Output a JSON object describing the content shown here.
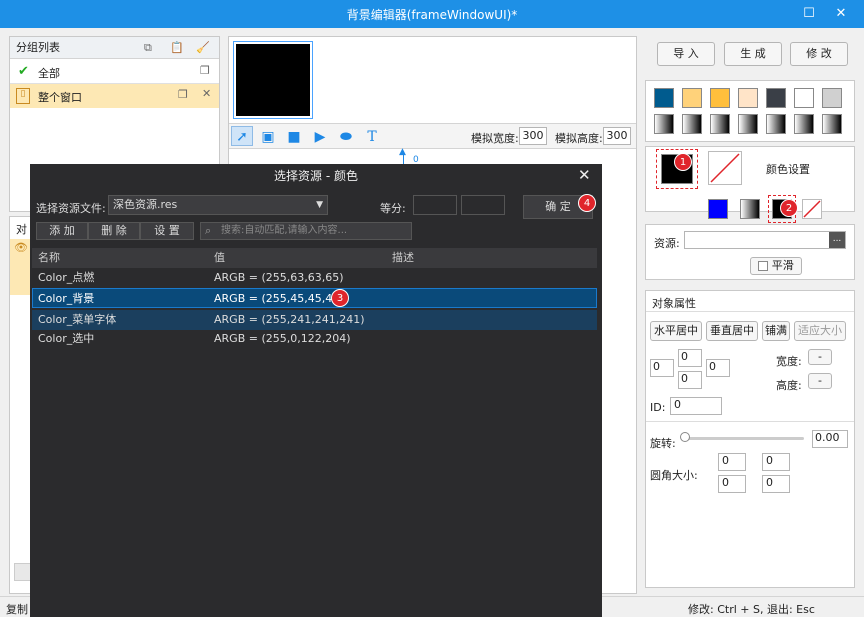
{
  "window": {
    "title": "背景编辑器(frameWindowUI)*",
    "maximize_icon": "maximize-icon",
    "close_icon": "close-icon"
  },
  "group_list": {
    "title": "分组列表",
    "items": [
      {
        "label": "全部",
        "icon": "check-icon"
      },
      {
        "label": "整个窗口",
        "icon": "window-icon"
      }
    ]
  },
  "object_panel": {
    "title_partial": "对"
  },
  "canvas": {
    "sim_width_label": "模拟宽度:",
    "sim_width": "300",
    "sim_height_label": "模拟高度:",
    "sim_height": "300",
    "tools": [
      "select-tool-icon",
      "image-tool-icon",
      "rect-tool-icon",
      "play-tool-icon",
      "ellipse-tool-icon",
      "text-tool-icon"
    ],
    "text_tool_glyph": "T",
    "marker_text": "0"
  },
  "toolbar": {
    "import": "导 入",
    "generate": "生 成",
    "modify": "修 改"
  },
  "colors": {
    "row1": [
      "#005b8e",
      "#ffd27a",
      "#ffbf3c",
      "#ffe4c8",
      "#3a3f47",
      "#ffffff",
      "#d0d0d0"
    ],
    "color_setting_label": "颜色设置",
    "fg": "#000000",
    "small": [
      "#0000ff"
    ]
  },
  "resource": {
    "label": "资源:",
    "browse": "...",
    "smooth_label": "平滑"
  },
  "object_props": {
    "title": "对象属性",
    "buttons": [
      "水平居中",
      "垂直居中",
      "铺满",
      "适应大小"
    ],
    "pos_values": [
      "0",
      "0",
      "0",
      "0"
    ],
    "width_label": "宽度:",
    "width_value": "-",
    "height_label": "高度:",
    "height_value": "-",
    "id_label": "ID:",
    "id_value": "0",
    "rotate_label": "旋转:",
    "rotate_value": "0.00",
    "radius_label": "圆角大小:",
    "radius_values": [
      "0",
      "0",
      "0",
      "0"
    ]
  },
  "status": {
    "left": "复制",
    "right": "修改: Ctrl + S, 退出: Esc"
  },
  "dialog": {
    "title": "选择资源 - 颜色",
    "file_label": "选择资源文件:",
    "file_value": "深色资源.res",
    "equal_label": "等分:",
    "ok_button": "确 定",
    "add": "添 加",
    "delete": "删 除",
    "settings": "设 置",
    "search_placeholder": "搜索:自动匹配,请输入内容...",
    "columns": [
      "名称",
      "值",
      "描述"
    ],
    "rows": [
      {
        "name": "Color_点燃",
        "value": "ARGB = (255,63,63,65)",
        "desc": ""
      },
      {
        "name": "Color_背景",
        "value": "ARGB = (255,45,45,48)",
        "desc": ""
      },
      {
        "name": "Color_菜单字体",
        "value": "ARGB = (255,241,241,241)",
        "desc": ""
      },
      {
        "name": "Color_选中",
        "value": "ARGB = (255,0,122,204)",
        "desc": ""
      }
    ]
  },
  "badges": [
    "1",
    "2",
    "3",
    "4"
  ]
}
